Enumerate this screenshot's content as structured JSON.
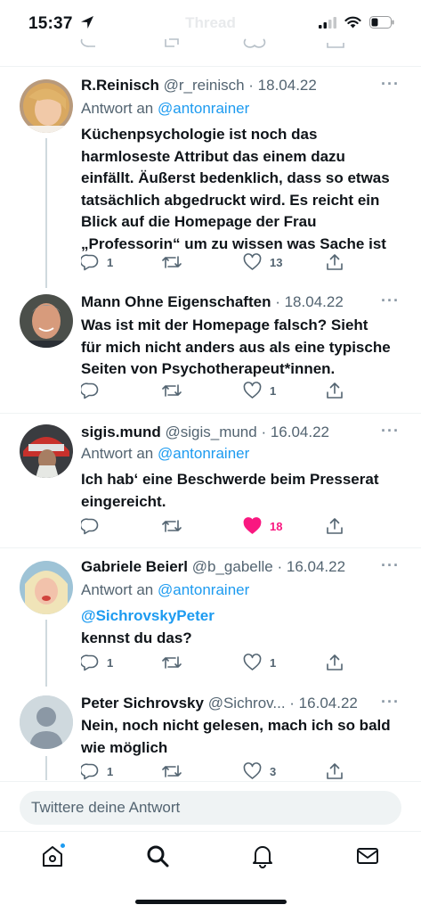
{
  "status_bar": {
    "time": "15:37",
    "faded_title": "Thread"
  },
  "tweets": [
    {
      "name": "R.Reinisch",
      "handle": "@r_reinisch",
      "date": "· 18.04.22",
      "reply_prefix": "Antwort an",
      "reply_to": "@antonrainer",
      "body_lines": [
        "Küchenpsychologie ist noch das",
        "harmloseste Attribut das einem dazu",
        "einfällt. Äußerst bedenklich, dass so etwas",
        "tatsächlich abgedruckt wird. Es reicht ein",
        "Blick auf die Homepage der Frau",
        "„Professorin“ um zu wissen was Sache ist"
      ],
      "replies": "1",
      "retweets": "",
      "likes": "13"
    },
    {
      "name": "Mann Ohne Eigenschaften",
      "handle": "",
      "date": "· 18.04.22",
      "body_lines": [
        "Was ist mit der Homepage falsch? Sieht",
        "für mich nicht anders aus als eine typische",
        "Seiten von Psychotherapeut*innen."
      ],
      "replies": "",
      "retweets": "",
      "likes": "1"
    },
    {
      "name": "sigis.mund",
      "handle": "@sigis_mund",
      "date": "· 16.04.22",
      "reply_prefix": "Antwort an",
      "reply_to": "@antonrainer",
      "body_lines": [
        "Ich hab‘ eine Beschwerde beim Presserat",
        "eingereicht."
      ],
      "replies": "",
      "retweets": "",
      "likes": "18",
      "liked": true
    },
    {
      "name": "Gabriele Beierl",
      "handle": "@b_gabelle",
      "date": "· 16.04.22",
      "reply_prefix": "Antwort an",
      "reply_to": "@antonrainer",
      "mention_line": "@SichrovskyPeter",
      "body_lines": [
        "kennst du das?"
      ],
      "replies": "1",
      "retweets": "",
      "likes": "1"
    },
    {
      "name": "Peter Sichrovsky",
      "handle": "@Sichrov...",
      "date": "· 16.04.22",
      "body_lines": [
        "Nein, noch nicht gelesen, mach ich so bald",
        "wie möglich"
      ],
      "replies": "1",
      "retweets": "",
      "likes": "3"
    }
  ],
  "reply_bar": {
    "placeholder": "Twittere deine Antwort"
  },
  "tab_bar": {
    "items": [
      {
        "name": "home-icon"
      },
      {
        "name": "search-icon",
        "active": true
      },
      {
        "name": "notifications-icon"
      },
      {
        "name": "messages-icon"
      }
    ]
  },
  "colors": {
    "accent": "#1d9bf0",
    "like": "#f91880",
    "muted": "#536471",
    "text": "#0f1419"
  }
}
